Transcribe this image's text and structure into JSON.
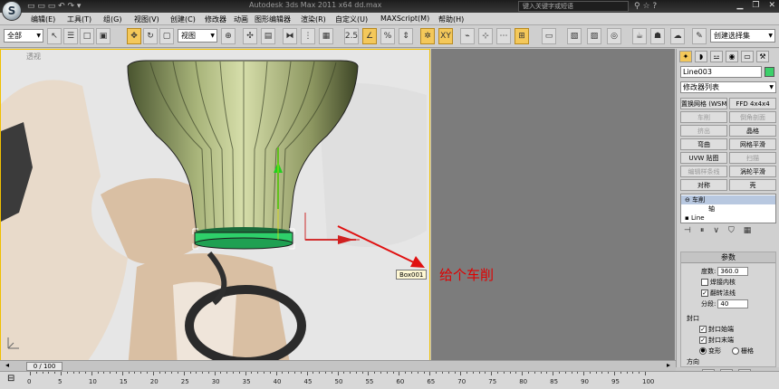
{
  "titlebar": {
    "title": "Autodesk 3ds Max  2011 x64      dd.max",
    "search_placeholder": "键入关键字或短语",
    "logo_glyph": "S"
  },
  "menu": [
    {
      "label": "编辑(E)"
    },
    {
      "label": "工具(T)"
    },
    {
      "label": "组(G)"
    },
    {
      "label": "视图(V)"
    },
    {
      "label": "创建(C)"
    },
    {
      "label": "修改器"
    },
    {
      "label": "动画"
    },
    {
      "label": "图形编辑器"
    },
    {
      "label": "渲染(R)"
    },
    {
      "label": "自定义(U)"
    },
    {
      "label": "MAXScript(M)"
    },
    {
      "label": "帮助(H)"
    }
  ],
  "toolbar": {
    "selection_filter": "全部",
    "reference_coord": "视图",
    "named_selection": "创建选择集",
    "snap_label": "2.5",
    "xy_label": "XY"
  },
  "viewport": {
    "label": "透视",
    "tooltip": "Box001",
    "annotation": "给个车削"
  },
  "panel": {
    "object_name": "Line003",
    "object_color": "#3cd06a",
    "modifier_list": "修改器列表",
    "modifier_buttons": [
      {
        "label": "置换网格 (WSM)",
        "enabled": true
      },
      {
        "label": "FFD 4x4x4",
        "enabled": true
      },
      {
        "label": "车削",
        "enabled": false
      },
      {
        "label": "倒角剖面",
        "enabled": false
      },
      {
        "label": "挤出",
        "enabled": false
      },
      {
        "label": "晶格",
        "enabled": true
      },
      {
        "label": "弯曲",
        "enabled": true
      },
      {
        "label": "网格平滑",
        "enabled": true
      },
      {
        "label": "UVW 贴图",
        "enabled": true
      },
      {
        "label": "扫描",
        "enabled": false
      },
      {
        "label": "编辑样条线",
        "enabled": false
      },
      {
        "label": "涡轮平滑",
        "enabled": true
      },
      {
        "label": "对称",
        "enabled": true
      },
      {
        "label": "壳",
        "enabled": true
      }
    ],
    "stack": [
      {
        "label": "车削",
        "selected": true
      },
      {
        "label": "轴",
        "selected": false
      },
      {
        "label": "Line",
        "selected": false
      }
    ],
    "params": {
      "title": "参数",
      "degrees_label": "度数:",
      "degrees_value": "360.0",
      "weld_core_label": "焊接内核",
      "flip_normals_label": "翻转法线",
      "segments_label": "分段:",
      "segments_value": "40",
      "capping_title": "封口",
      "cap_start_label": "封口始端",
      "cap_end_label": "封口末端",
      "morph_label": "变形",
      "grid_label": "栅格",
      "direction_title": "方向",
      "axes": [
        "X",
        "Y",
        "Z"
      ]
    }
  },
  "timeline": {
    "slider_label": "0 / 100",
    "ticks": [
      "0",
      "5",
      "10",
      "15",
      "20",
      "25",
      "30",
      "35",
      "40",
      "45",
      "50",
      "55",
      "60",
      "65",
      "70",
      "75",
      "80",
      "85",
      "90",
      "95",
      "100"
    ]
  }
}
